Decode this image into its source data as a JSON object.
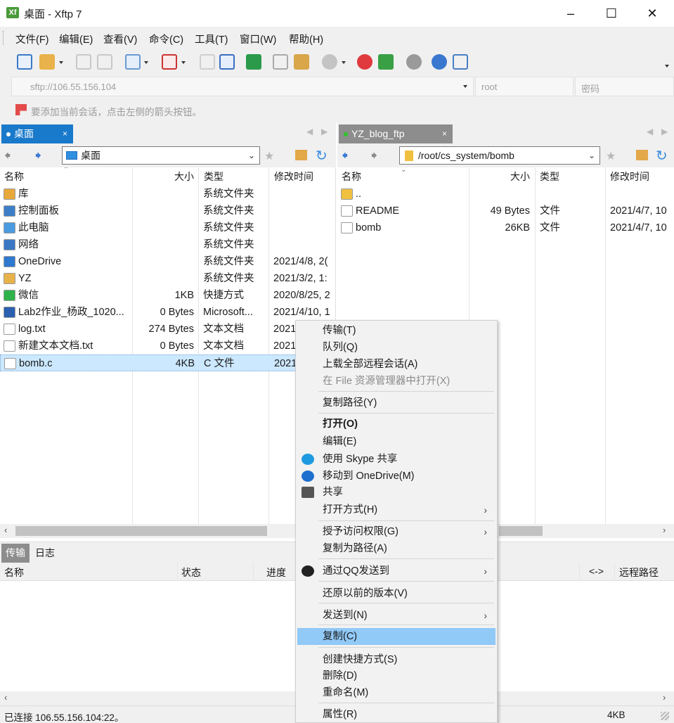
{
  "window": {
    "title": "桌面 - Xftp 7",
    "app_icon_glyph": "Xf"
  },
  "menu": [
    "文件(F)",
    "编辑(E)",
    "查看(V)",
    "命令(C)",
    "工具(T)",
    "窗口(W)",
    "帮助(H)"
  ],
  "address": {
    "host_placeholder": "sftp://106.55.156.104",
    "user_placeholder": "root",
    "password_placeholder": "密码"
  },
  "hint": "要添加当前会话，点击左侧的箭头按钮。",
  "left_tab": {
    "label": "桌面",
    "close": "×"
  },
  "right_tab": {
    "label": "YZ_blog_ftp",
    "close": "×"
  },
  "left_path": "桌面",
  "right_path": "/root/cs_system/bomb",
  "left_columns": [
    "名称",
    "大小",
    "类型",
    "修改时间"
  ],
  "right_columns": [
    "名称",
    "大小",
    "类型",
    "修改时间"
  ],
  "left_files": [
    {
      "name": "库",
      "size": "",
      "type": "系统文件夹",
      "modified": "",
      "icon": "library-icon",
      "color": "#e8a93a"
    },
    {
      "name": "控制面板",
      "size": "",
      "type": "系统文件夹",
      "modified": "",
      "icon": "control-panel-icon",
      "color": "#3c7fc8"
    },
    {
      "name": "此电脑",
      "size": "",
      "type": "系统文件夹",
      "modified": "",
      "icon": "computer-icon",
      "color": "#4a9be0"
    },
    {
      "name": "网络",
      "size": "",
      "type": "系统文件夹",
      "modified": "",
      "icon": "network-icon",
      "color": "#3a78c4"
    },
    {
      "name": "OneDrive",
      "size": "",
      "type": "系统文件夹",
      "modified": "2021/4/8, 2(",
      "icon": "onedrive-icon",
      "color": "#2f78d0"
    },
    {
      "name": "YZ",
      "size": "",
      "type": "系统文件夹",
      "modified": "2021/3/2, 1:",
      "icon": "user-folder-icon",
      "color": "#e8b24a"
    },
    {
      "name": "微信",
      "size": "1KB",
      "type": "快捷方式",
      "modified": "2020/8/25, 2",
      "icon": "wechat-icon",
      "color": "#2fb24a"
    },
    {
      "name": "Lab2作业_杨政_1020...",
      "size": "0 Bytes",
      "type": "Microsoft...",
      "modified": "2021/4/10, 1",
      "icon": "word-icon",
      "color": "#2b5fb0"
    },
    {
      "name": "log.txt",
      "size": "274 Bytes",
      "type": "文本文档",
      "modified": "2021",
      "icon": "text-file-icon",
      "color": "#ffffff"
    },
    {
      "name": "新建文本文档.txt",
      "size": "0 Bytes",
      "type": "文本文档",
      "modified": "2021",
      "icon": "text-file-icon",
      "color": "#ffffff"
    },
    {
      "name": "bomb.c",
      "size": "4KB",
      "type": "C 文件",
      "modified": "2021",
      "icon": "c-file-icon",
      "color": "#ffffff",
      "selected": true
    }
  ],
  "right_files": [
    {
      "name": "..",
      "size": "",
      "type": "",
      "modified": "",
      "icon": "folder-up-icon",
      "color": "#f0c040"
    },
    {
      "name": "README",
      "size": "49 Bytes",
      "type": "文件",
      "modified": "2021/4/7, 10",
      "icon": "file-icon",
      "color": "#ffffff"
    },
    {
      "name": "bomb",
      "size": "26KB",
      "type": "文件",
      "modified": "2021/4/7, 10",
      "icon": "file-icon",
      "color": "#ffffff"
    }
  ],
  "transfer_tabs": [
    "传输",
    "日志"
  ],
  "transfer_columns": [
    "名称",
    "状态",
    "进度",
    "<->",
    "远程路径"
  ],
  "status": {
    "connected": "已连接 106.55.156.104:22。",
    "size": "4KB"
  },
  "context_menu": [
    {
      "label": "传输(T)",
      "bold": false,
      "disabled": false
    },
    {
      "label": "队列(Q)",
      "bold": false,
      "disabled": false
    },
    {
      "label": "上载全部远程会话(A)",
      "bold": false,
      "disabled": false
    },
    {
      "label": "在 File 资源管理器中打开(X)",
      "bold": false,
      "disabled": true
    },
    {
      "label": "复制路径(Y)",
      "bold": false,
      "disabled": false
    },
    {
      "label": "打开(O)",
      "bold": true,
      "disabled": false
    },
    {
      "label": "编辑(E)",
      "bold": false,
      "disabled": false
    },
    {
      "label": "使用 Skype 共享",
      "bold": false,
      "disabled": false,
      "icon": "skype-icon"
    },
    {
      "label": "移动到 OneDrive(M)",
      "bold": false,
      "disabled": false,
      "icon": "onedrive-icon"
    },
    {
      "label": "共享",
      "bold": false,
      "disabled": false,
      "icon": "share-icon"
    },
    {
      "label": "打开方式(H)",
      "bold": false,
      "disabled": false,
      "submenu": true
    },
    {
      "label": "授予访问权限(G)",
      "bold": false,
      "disabled": false,
      "submenu": true
    },
    {
      "label": "复制为路径(A)",
      "bold": false,
      "disabled": false
    },
    {
      "label": "通过QQ发送到",
      "bold": false,
      "disabled": false,
      "submenu": true,
      "icon": "qq-icon"
    },
    {
      "label": "还原以前的版本(V)",
      "bold": false,
      "disabled": false
    },
    {
      "label": "发送到(N)",
      "bold": false,
      "disabled": false,
      "submenu": true
    },
    {
      "label": "复制(C)",
      "bold": false,
      "disabled": false,
      "highlighted": true
    },
    {
      "label": "创建快捷方式(S)",
      "bold": false,
      "disabled": false
    },
    {
      "label": "删除(D)",
      "bold": false,
      "disabled": false
    },
    {
      "label": "重命名(M)",
      "bold": false,
      "disabled": false
    },
    {
      "label": "属性(R)",
      "bold": false,
      "disabled": false
    }
  ],
  "colors": {
    "accent": "#0078d7",
    "highlight": "#91c9f7",
    "selected_row": "#cce8ff",
    "tab_active": "#1979ca",
    "tab_remote": "#8d8d8d",
    "connected_dot": "#2cc52c"
  }
}
